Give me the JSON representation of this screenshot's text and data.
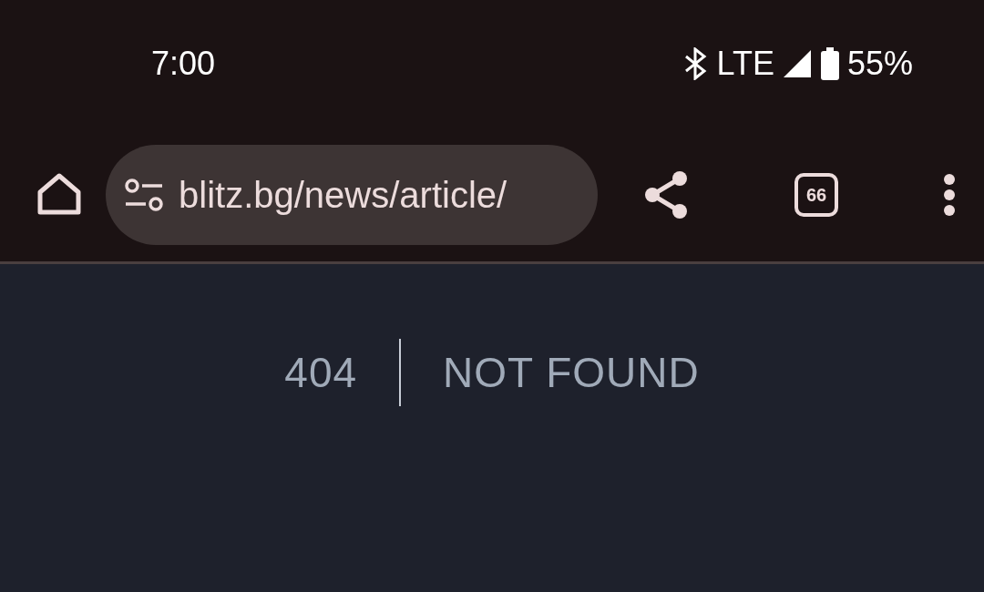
{
  "status_bar": {
    "time": "7:00",
    "network": "LTE",
    "battery": "55%"
  },
  "toolbar": {
    "url": "blitz.bg/news/article/",
    "tab_count": "66"
  },
  "page": {
    "code": "404",
    "message": "NOT FOUND"
  }
}
